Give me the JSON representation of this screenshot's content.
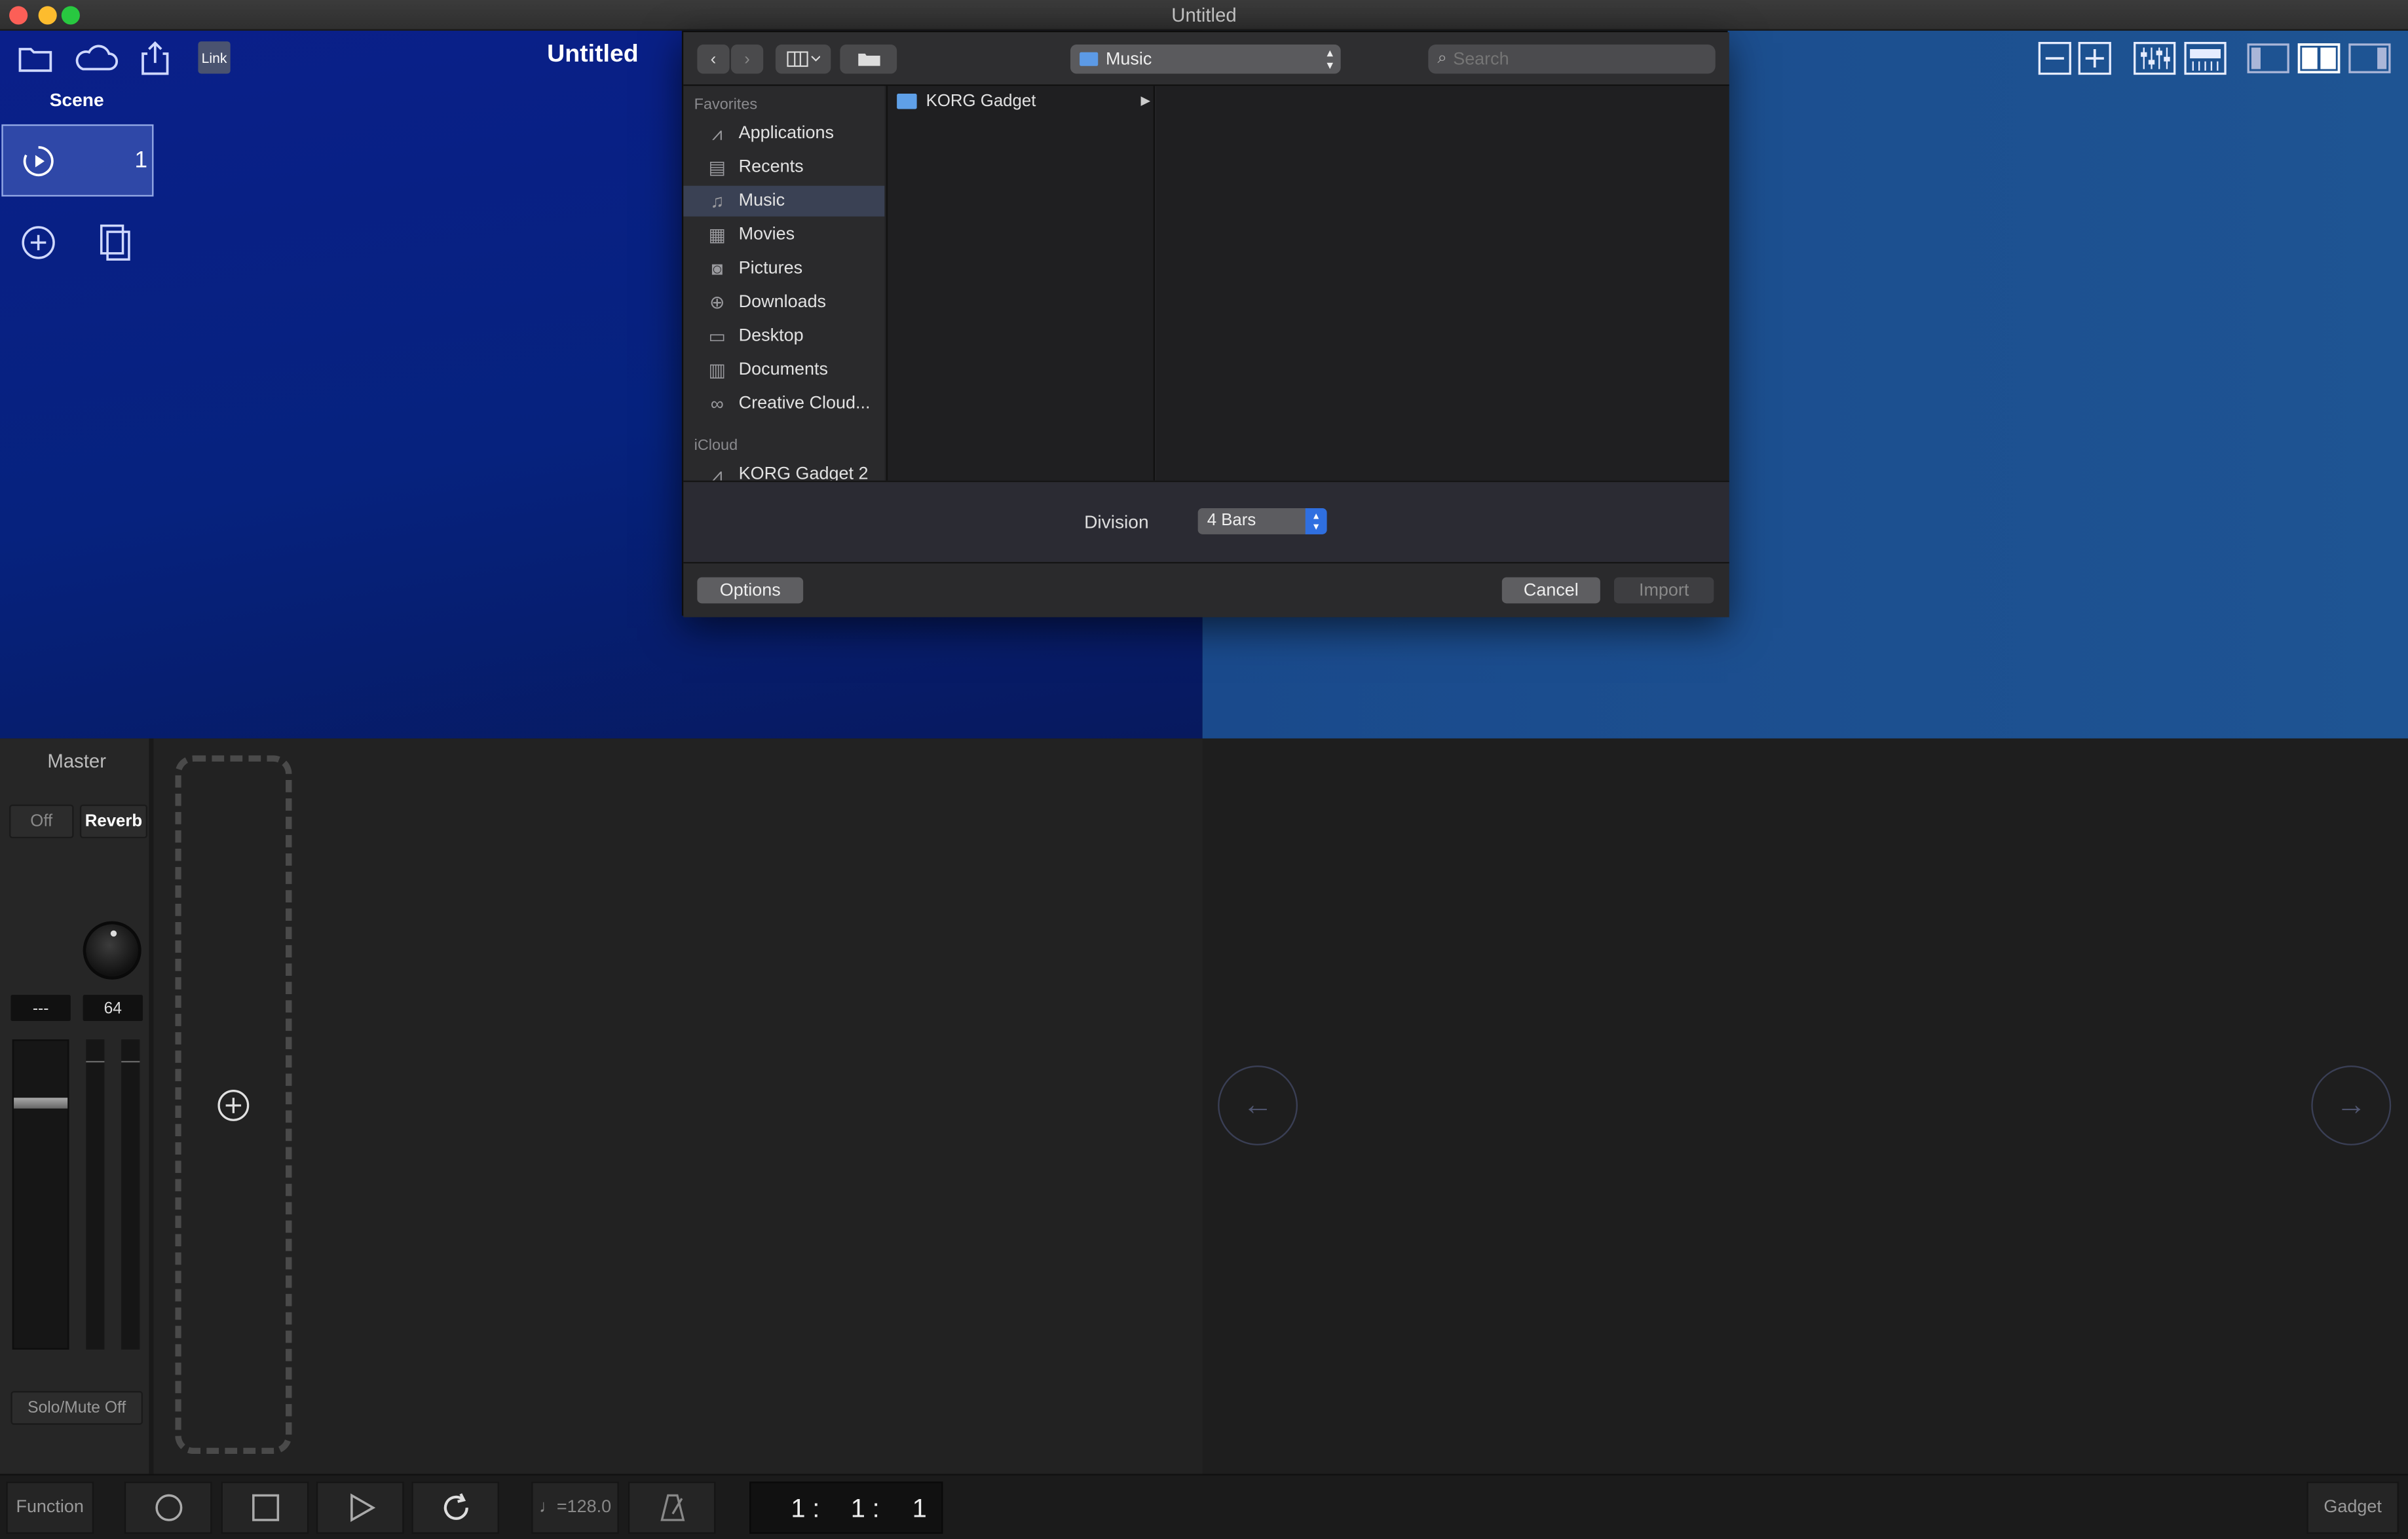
{
  "window": {
    "title": "Untitled"
  },
  "toolbar": {
    "link_label": "Link"
  },
  "doc_title": "Untitled",
  "scene": {
    "label": "Scene",
    "number": "1"
  },
  "dialog": {
    "location": "Music",
    "search_placeholder": "Search",
    "sidebar": {
      "favorites_header": "Favorites",
      "icloud_header": "iCloud",
      "items": [
        "Applications",
        "Recents",
        "Music",
        "Movies",
        "Pictures",
        "Downloads",
        "Desktop",
        "Documents",
        "Creative Cloud..."
      ],
      "icloud_items": [
        "KORG Gadget 2"
      ]
    },
    "files": [
      "KORG Gadget"
    ],
    "division_label": "Division",
    "division_value": "4 Bars",
    "options_label": "Options",
    "cancel_label": "Cancel",
    "import_label": "Import"
  },
  "master": {
    "label": "Master",
    "off_label": "Off",
    "reverb_label": "Reverb",
    "left_value": "---",
    "right_value": "64",
    "solo_mute_label": "Solo/Mute Off"
  },
  "transport": {
    "function_label": "Function",
    "tempo": "♩=128.0",
    "position": [
      "1",
      "1",
      "1"
    ],
    "gadget_label": "Gadget"
  },
  "colors": {
    "accent": "#2f6fe0",
    "scene_bg": "#0a1f8a",
    "selected_sidebar": "#3a4154"
  }
}
